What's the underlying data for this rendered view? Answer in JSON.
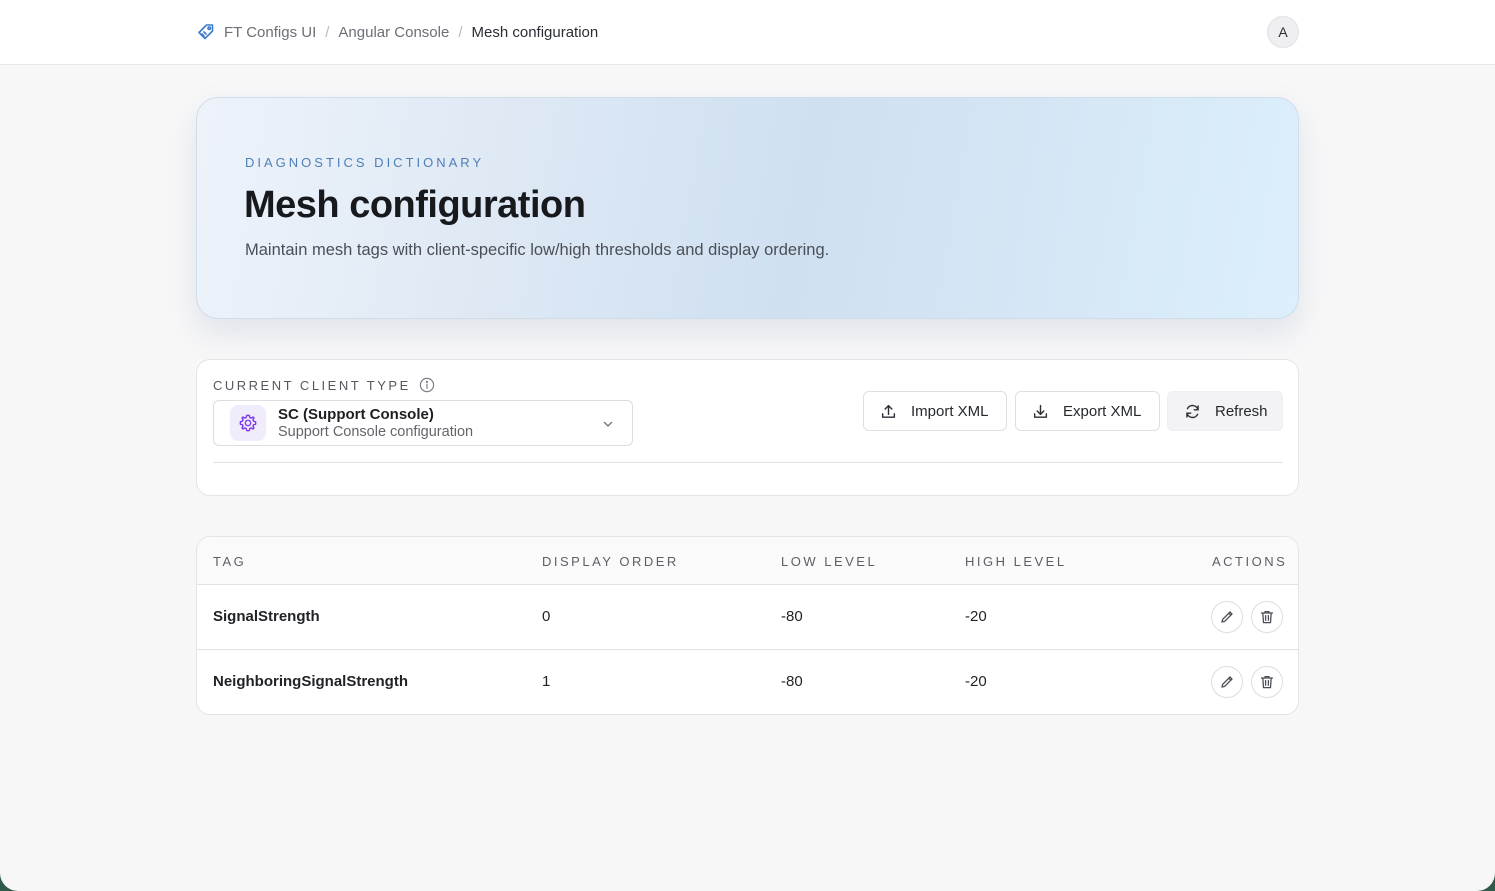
{
  "breadcrumb": {
    "items": [
      "FT Configs UI",
      "Angular Console"
    ],
    "current": "Mesh configuration",
    "separator": "/"
  },
  "user": {
    "avatar_initial": "A"
  },
  "hero": {
    "eyebrow": "DIAGNOSTICS DICTIONARY",
    "title": "Mesh configuration",
    "subtitle": "Maintain mesh tags with client-specific low/high thresholds and display ordering."
  },
  "client": {
    "label": "CURRENT CLIENT TYPE",
    "selected_title": "SC (Support Console)",
    "selected_subtitle": "Support Console configuration",
    "icon": "gear-icon"
  },
  "actions": {
    "import_label": "Import XML",
    "export_label": "Export XML",
    "refresh_label": "Refresh"
  },
  "table": {
    "headers": {
      "tag": "TAG",
      "display_order": "DISPLAY ORDER",
      "low_level": "LOW LEVEL",
      "high_level": "HIGH LEVEL",
      "actions": "ACTIONS"
    },
    "rows": [
      {
        "tag": "SignalStrength",
        "display_order": "0",
        "low_level": "-80",
        "high_level": "-20"
      },
      {
        "tag": "NeighboringSignalStrength",
        "display_order": "1",
        "low_level": "-80",
        "high_level": "-20"
      }
    ]
  },
  "colors": {
    "accent_blue": "#4e7fb8",
    "gear_purple": "#7c3aed",
    "page_bg": "#f7f7f8"
  }
}
